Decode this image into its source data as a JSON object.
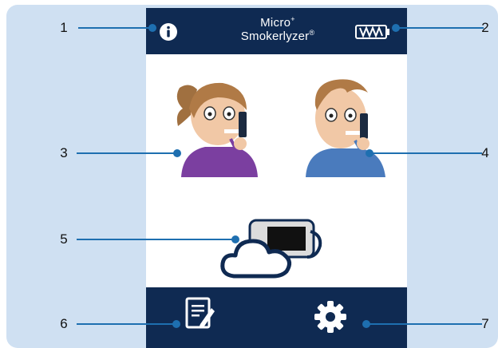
{
  "header": {
    "brand_top": "Micro",
    "brand_sup": "+",
    "brand_bottom": "Smokerlyzer",
    "brand_reg": "®"
  },
  "icons": {
    "info": "info-icon",
    "battery": "battery-icon",
    "female_user": "female-user-icon",
    "male_user": "male-user-icon",
    "cloud": "cloud-device-icon",
    "notes": "notes-icon",
    "settings": "gear-icon"
  },
  "callouts": [
    "1",
    "2",
    "3",
    "4",
    "5",
    "6",
    "7"
  ],
  "colors": {
    "navy": "#0f2a52",
    "backdrop": "#cfe0f2",
    "callout": "#1e6fb0"
  }
}
